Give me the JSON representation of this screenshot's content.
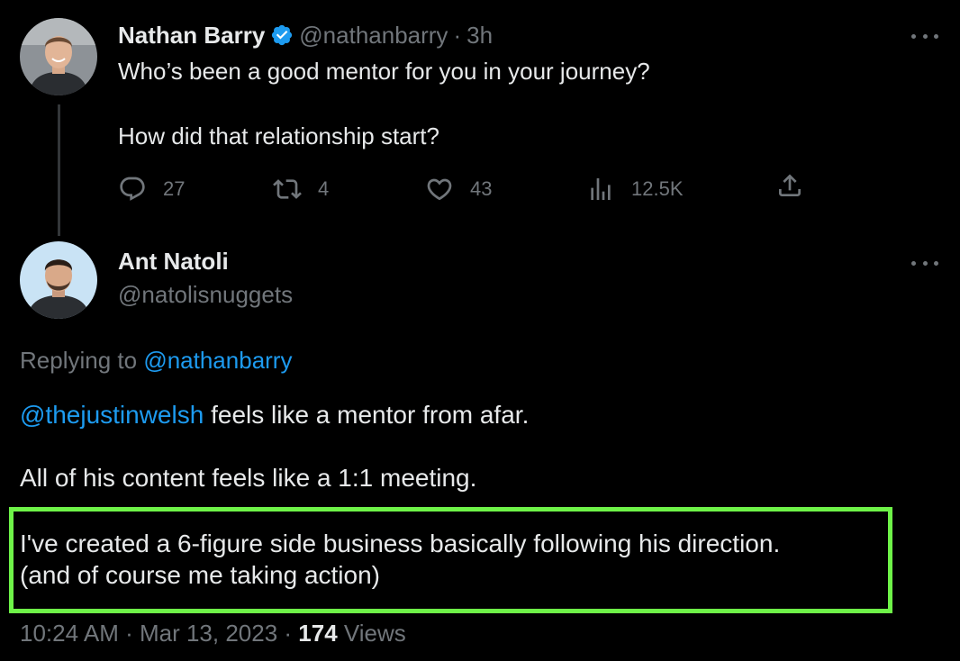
{
  "colors": {
    "background": "#000000",
    "text_primary": "#e7e9ea",
    "text_secondary": "#71767b",
    "link": "#1d9bf0",
    "verified_badge": "#1d9bf0",
    "highlight_border": "#6ef348"
  },
  "original_tweet": {
    "author_name": "Nathan Barry",
    "verified": true,
    "handle": "@nathanbarry",
    "separator": "·",
    "time": "3h",
    "text_line1": "Who’s been a good mentor for you in your journey?",
    "text_line2": "How did that relationship start?",
    "actions": {
      "replies": {
        "icon": "reply-icon",
        "count": "27"
      },
      "retweets": {
        "icon": "retweet-icon",
        "count": "4"
      },
      "likes": {
        "icon": "heart-icon",
        "count": "43"
      },
      "views": {
        "icon": "analytics-icon",
        "count": "12.5K"
      },
      "share": {
        "icon": "share-icon"
      }
    }
  },
  "reply_tweet": {
    "author_name": "Ant Natoli",
    "handle": "@natolisnuggets",
    "replying_to_prefix": "Replying to ",
    "replying_to_handle": "@nathanbarry",
    "mention": "@thejustinwelsh",
    "line1_rest": " feels like a mentor from afar.",
    "line2": "All of his content feels like a 1:1 meeting.",
    "line3": "I've created a 6-figure side business basically following his direction.",
    "line4": "(and of course me taking action)",
    "timestamp": "10:24 AM · Mar 13, 2023 · ",
    "views_count": "174",
    "views_label": " Views"
  }
}
